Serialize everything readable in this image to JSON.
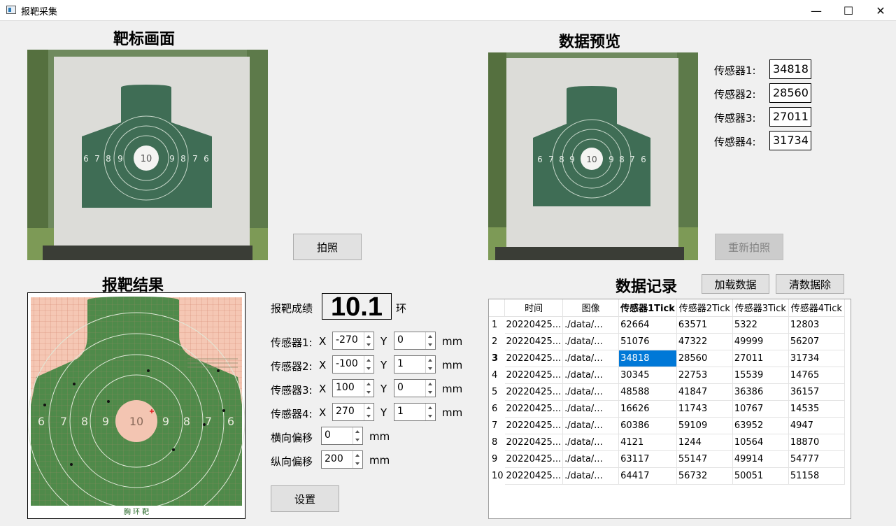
{
  "window": {
    "title": "报靶采集",
    "minimize": "—",
    "maximize": "☐",
    "close": "✕"
  },
  "sections": {
    "target_view": "靶标画面",
    "data_preview": "数据预览",
    "result": "报靶结果",
    "records": "数据记录"
  },
  "buttons": {
    "capture": "拍照",
    "recapture": "重新拍照",
    "load": "加载数据",
    "clear": "清数据除",
    "settings": "设置"
  },
  "target_image": {
    "numbers": [
      "6",
      "7",
      "8",
      "9",
      "10",
      "9",
      "8",
      "7",
      "6"
    ]
  },
  "preview": {
    "sensors": [
      {
        "label": "传感器1:",
        "value": "34818"
      },
      {
        "label": "传感器2:",
        "value": "28560"
      },
      {
        "label": "传感器3:",
        "value": "27011"
      },
      {
        "label": "传感器4:",
        "value": "31734"
      }
    ]
  },
  "result": {
    "score_label": "报靶成绩",
    "score": "10.1",
    "score_unit": "环",
    "sensors": [
      {
        "label": "传感器1:",
        "x_label": "X",
        "x": "-270",
        "y_label": "Y",
        "y": "0",
        "unit": "mm"
      },
      {
        "label": "传感器2:",
        "x_label": "X",
        "x": "-100",
        "y_label": "Y",
        "y": "1",
        "unit": "mm"
      },
      {
        "label": "传感器3:",
        "x_label": "X",
        "x": "100",
        "y_label": "Y",
        "y": "0",
        "unit": "mm"
      },
      {
        "label": "传感器4:",
        "x_label": "X",
        "x": "270",
        "y_label": "Y",
        "y": "1",
        "unit": "mm"
      }
    ],
    "h_offset_label": "横向偏移",
    "h_offset": "0",
    "h_offset_unit": "mm",
    "v_offset_label": "纵向偏移",
    "v_offset": "200",
    "v_offset_unit": "mm",
    "target_caption": "胸 环 靶",
    "target_numbers": [
      "6",
      "7",
      "8",
      "9",
      "10",
      "9",
      "8",
      "7",
      "6"
    ]
  },
  "table": {
    "headers": [
      "时间",
      "图像",
      "传感器1Tick",
      "传感器2Tick",
      "传感器3Tick",
      "传感器4Tick"
    ],
    "rows": [
      {
        "n": "1",
        "cells": [
          "20220425...",
          "./data/...",
          "62664",
          "63571",
          "5322",
          "12803"
        ]
      },
      {
        "n": "2",
        "cells": [
          "20220425...",
          "./data/...",
          "51076",
          "47322",
          "49999",
          "56207"
        ]
      },
      {
        "n": "3",
        "cells": [
          "20220425...",
          "./data/...",
          "34818",
          "28560",
          "27011",
          "31734"
        ]
      },
      {
        "n": "4",
        "cells": [
          "20220425...",
          "./data/...",
          "30345",
          "22753",
          "15539",
          "14765"
        ]
      },
      {
        "n": "5",
        "cells": [
          "20220425...",
          "./data/...",
          "48588",
          "41847",
          "36386",
          "36157"
        ]
      },
      {
        "n": "6",
        "cells": [
          "20220425...",
          "./data/...",
          "16626",
          "11743",
          "10767",
          "14535"
        ]
      },
      {
        "n": "7",
        "cells": [
          "20220425...",
          "./data/...",
          "60386",
          "59109",
          "63952",
          "4947"
        ]
      },
      {
        "n": "8",
        "cells": [
          "20220425...",
          "./data/...",
          "4121",
          "1244",
          "10564",
          "18870"
        ]
      },
      {
        "n": "9",
        "cells": [
          "20220425...",
          "./data/...",
          "63117",
          "55147",
          "49914",
          "54777"
        ]
      },
      {
        "n": "10",
        "cells": [
          "20220425...",
          "./data/...",
          "64417",
          "56732",
          "50051",
          "51158"
        ]
      }
    ]
  },
  "colors": {
    "target_green": "#3f7a5a",
    "grid_pink": "#f5c7b4",
    "selection": "#0078d7"
  }
}
